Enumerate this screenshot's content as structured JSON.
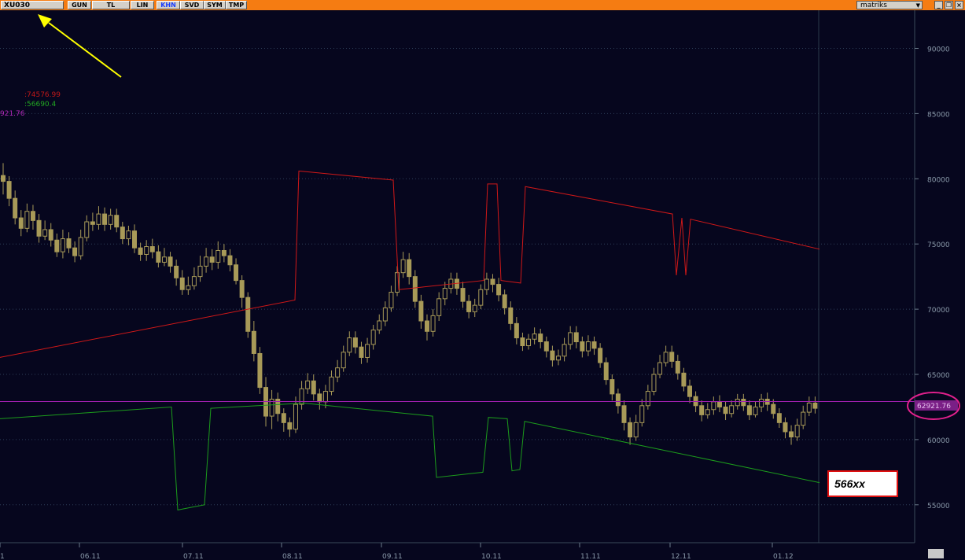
{
  "toolbar": {
    "symbol": "XU030",
    "buttons": [
      "GUN",
      "TL",
      "LIN",
      "KHN",
      "SVD",
      "SYM",
      "TMP"
    ],
    "active_button": "KHN",
    "brand": "matriks",
    "window_controls": [
      "minimize-icon",
      "restore-icon",
      "close-icon"
    ]
  },
  "chart_data": {
    "type": "candlestick",
    "y_axis": {
      "ticks": [
        55000,
        60000,
        65000,
        70000,
        75000,
        80000,
        85000,
        90000
      ],
      "tick_labels": [
        "55000",
        "60000",
        "65000",
        "70000",
        "75000",
        "80000",
        "85000",
        "90000"
      ],
      "range": [
        51500,
        93500
      ],
      "position": "right"
    },
    "x_axis": {
      "tick_labels": [
        "1",
        "06.11",
        "07.11",
        "08.11",
        "09.11",
        "10.11",
        "11.11",
        "12.11",
        "01.12"
      ]
    },
    "grid": "horizontal-dotted",
    "legend_values": {
      "upper": ":74576.99",
      "lower": ":56690.4",
      "price": "921.76"
    },
    "last_price_label": "62921.76",
    "annotation_box": "566xx",
    "colors": {
      "candle": "#a89a58",
      "upper_band": "#d01818",
      "lower_band": "#1c9c1c",
      "price_line": "#a020b0",
      "highlight_ellipse": "#e0208c",
      "arrow": "#ffff00",
      "annotation_border": "#e01010"
    },
    "upper_band": [
      [
        0,
        66300
      ],
      [
        375,
        70700
      ],
      [
        380,
        80600
      ],
      [
        500,
        79900
      ],
      [
        507,
        71500
      ],
      [
        615,
        72200
      ],
      [
        620,
        79600
      ],
      [
        632,
        79600
      ],
      [
        637,
        72200
      ],
      [
        662,
        72000
      ],
      [
        668,
        79400
      ],
      [
        855,
        77300
      ],
      [
        860,
        72600
      ],
      [
        867,
        77000
      ],
      [
        872,
        72600
      ],
      [
        878,
        76900
      ],
      [
        1042,
        74600
      ]
    ],
    "lower_band": [
      [
        0,
        61600
      ],
      [
        218,
        62500
      ],
      [
        226,
        54600
      ],
      [
        260,
        55000
      ],
      [
        268,
        62400
      ],
      [
        386,
        62800
      ],
      [
        550,
        61800
      ],
      [
        555,
        57100
      ],
      [
        614,
        57500
      ],
      [
        621,
        61700
      ],
      [
        645,
        61600
      ],
      [
        651,
        57600
      ],
      [
        661,
        57700
      ],
      [
        667,
        61400
      ],
      [
        1042,
        56700
      ]
    ],
    "price_line": 62921.76,
    "candles": [
      [
        80250,
        79800,
        81200,
        78800
      ],
      [
        79800,
        78500,
        80200,
        77900
      ],
      [
        78500,
        77000,
        79100,
        76500
      ],
      [
        77000,
        76200,
        77600,
        75600
      ],
      [
        76200,
        77500,
        78100,
        75900
      ],
      [
        77500,
        76800,
        78000,
        76100
      ],
      [
        76800,
        75600,
        77300,
        75100
      ],
      [
        75600,
        76100,
        76800,
        75300
      ],
      [
        76100,
        75300,
        76600,
        74800
      ],
      [
        75300,
        74400,
        75800,
        74000
      ],
      [
        74400,
        75400,
        76100,
        73900
      ],
      [
        75400,
        74700,
        75900,
        74300
      ],
      [
        74700,
        74100,
        75200,
        73600
      ],
      [
        74100,
        75500,
        76100,
        73800
      ],
      [
        75500,
        76700,
        77200,
        75200
      ],
      [
        76700,
        76500,
        77400,
        76000
      ],
      [
        76500,
        77300,
        77900,
        76100
      ],
      [
        77300,
        76500,
        77800,
        76000
      ],
      [
        76500,
        77200,
        77700,
        76100
      ],
      [
        77200,
        76300,
        77700,
        75900
      ],
      [
        76300,
        75400,
        76700,
        75000
      ],
      [
        75400,
        76000,
        76400,
        74900
      ],
      [
        76000,
        74700,
        76500,
        74300
      ],
      [
        74700,
        74200,
        75100,
        73700
      ],
      [
        74200,
        74800,
        75300,
        73700
      ],
      [
        74800,
        74400,
        75400,
        73900
      ],
      [
        74400,
        73600,
        74900,
        73200
      ],
      [
        73600,
        74000,
        74700,
        73300
      ],
      [
        74000,
        73300,
        74400,
        72800
      ],
      [
        73300,
        72400,
        73800,
        71800
      ],
      [
        72400,
        71500,
        73000,
        71100
      ],
      [
        71500,
        71800,
        72500,
        71100
      ],
      [
        71800,
        72500,
        73200,
        71500
      ],
      [
        72500,
        73300,
        74100,
        72100
      ],
      [
        73300,
        74000,
        74700,
        72800
      ],
      [
        74000,
        73600,
        74600,
        73000
      ],
      [
        73600,
        74500,
        75200,
        73100
      ],
      [
        74500,
        74100,
        75000,
        73600
      ],
      [
        74100,
        73400,
        74600,
        72900
      ],
      [
        73400,
        72200,
        73900,
        71900
      ],
      [
        72200,
        70900,
        72600,
        70100
      ],
      [
        70900,
        68300,
        71300,
        67800
      ],
      [
        68300,
        66600,
        69100,
        66000
      ],
      [
        66600,
        64000,
        67100,
        63500
      ],
      [
        64000,
        61800,
        64800,
        61000
      ],
      [
        61800,
        63100,
        63800,
        60800
      ],
      [
        63100,
        62000,
        63600,
        61400
      ],
      [
        62000,
        61300,
        62400,
        60600
      ],
      [
        61300,
        60800,
        61700,
        60200
      ],
      [
        60800,
        62700,
        63300,
        60500
      ],
      [
        62700,
        63900,
        64500,
        62300
      ],
      [
        63900,
        64500,
        65100,
        63500
      ],
      [
        64500,
        63500,
        65000,
        63000
      ],
      [
        63500,
        62900,
        63900,
        62300
      ],
      [
        62900,
        63700,
        64200,
        62400
      ],
      [
        63700,
        64800,
        65300,
        63400
      ],
      [
        64800,
        65500,
        66100,
        64400
      ],
      [
        65500,
        66700,
        67200,
        65200
      ],
      [
        66700,
        67800,
        68300,
        66400
      ],
      [
        67800,
        67100,
        68300,
        66600
      ],
      [
        67100,
        66300,
        67500,
        65800
      ],
      [
        66300,
        67300,
        67800,
        65900
      ],
      [
        67300,
        68400,
        68800,
        66900
      ],
      [
        68400,
        69100,
        69600,
        68100
      ],
      [
        69100,
        70100,
        70600,
        68700
      ],
      [
        70100,
        71300,
        71800,
        69800
      ],
      [
        71300,
        72800,
        73300,
        71000
      ],
      [
        72800,
        73800,
        74400,
        72400
      ],
      [
        73800,
        72500,
        74300,
        71900
      ],
      [
        72500,
        70600,
        73000,
        70100
      ],
      [
        70600,
        69100,
        71100,
        68500
      ],
      [
        69100,
        68300,
        69600,
        67600
      ],
      [
        68300,
        69500,
        70000,
        67900
      ],
      [
        69500,
        70800,
        71300,
        69100
      ],
      [
        70800,
        71600,
        72100,
        70300
      ],
      [
        71600,
        72300,
        72800,
        71200
      ],
      [
        72300,
        71600,
        72800,
        71100
      ],
      [
        71600,
        70600,
        72100,
        70100
      ],
      [
        70600,
        69800,
        71100,
        69300
      ],
      [
        69800,
        70300,
        70800,
        69400
      ],
      [
        70300,
        71500,
        71900,
        70000
      ],
      [
        71500,
        72300,
        72800,
        71100
      ],
      [
        72300,
        71900,
        72700,
        71300
      ],
      [
        71900,
        71100,
        72400,
        70600
      ],
      [
        71100,
        70100,
        71500,
        69600
      ],
      [
        70100,
        68900,
        70600,
        68400
      ],
      [
        68900,
        67800,
        69400,
        67300
      ],
      [
        67800,
        67200,
        68200,
        66800
      ],
      [
        67200,
        67700,
        68100,
        66900
      ],
      [
        67700,
        68100,
        68600,
        67300
      ],
      [
        68100,
        67500,
        68500,
        67000
      ],
      [
        67500,
        66800,
        67900,
        66300
      ],
      [
        66800,
        66100,
        67200,
        65600
      ],
      [
        66100,
        66400,
        66900,
        65700
      ],
      [
        66400,
        67300,
        67800,
        66000
      ],
      [
        67300,
        68200,
        68700,
        66900
      ],
      [
        68200,
        67500,
        68700,
        67000
      ],
      [
        67500,
        66800,
        67900,
        66300
      ],
      [
        66800,
        67500,
        68000,
        66400
      ],
      [
        67500,
        67000,
        67900,
        66500
      ],
      [
        67000,
        65900,
        67400,
        65500
      ],
      [
        65900,
        64600,
        66300,
        64200
      ],
      [
        64600,
        63500,
        65000,
        63000
      ],
      [
        63500,
        62600,
        63900,
        62000
      ],
      [
        62600,
        61300,
        63000,
        60700
      ],
      [
        61300,
        60200,
        61700,
        59600
      ],
      [
        60200,
        61300,
        61900,
        59900
      ],
      [
        61300,
        62600,
        63100,
        61000
      ],
      [
        62600,
        63700,
        64200,
        62300
      ],
      [
        63700,
        65000,
        65500,
        63400
      ],
      [
        65000,
        65900,
        66500,
        64700
      ],
      [
        65900,
        66700,
        67200,
        65600
      ],
      [
        66700,
        66000,
        67200,
        65500
      ],
      [
        66000,
        65100,
        66500,
        64600
      ],
      [
        65100,
        64100,
        65500,
        63700
      ],
      [
        64100,
        63300,
        64600,
        62800
      ],
      [
        63300,
        62600,
        63700,
        62100
      ],
      [
        62600,
        61900,
        63000,
        61400
      ],
      [
        61900,
        62300,
        62800,
        61600
      ],
      [
        62300,
        62900,
        63300,
        61900
      ],
      [
        62900,
        62500,
        63400,
        62100
      ],
      [
        62500,
        62000,
        62900,
        61500
      ],
      [
        62000,
        62600,
        63000,
        61700
      ],
      [
        62600,
        63100,
        63500,
        62300
      ],
      [
        63100,
        62600,
        63500,
        62200
      ],
      [
        62600,
        61900,
        63000,
        61500
      ],
      [
        61900,
        62500,
        62900,
        61700
      ],
      [
        62500,
        63100,
        63500,
        62100
      ],
      [
        63100,
        62700,
        63600,
        62200
      ],
      [
        62700,
        62000,
        63100,
        61600
      ],
      [
        62000,
        61300,
        62400,
        60900
      ],
      [
        61300,
        60600,
        61700,
        60100
      ],
      [
        60600,
        60200,
        61100,
        59600
      ],
      [
        60200,
        61100,
        61600,
        59900
      ],
      [
        61100,
        62100,
        62600,
        60800
      ],
      [
        62100,
        62800,
        63300,
        61800
      ],
      [
        62800,
        62400,
        63300,
        62000
      ]
    ]
  },
  "arrow_target": "symbol-box"
}
